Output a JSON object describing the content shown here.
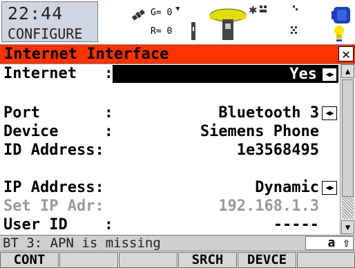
{
  "header": {
    "clock": "22:44",
    "mode": "CONFIGURE",
    "gps": {
      "g_label": "G= 0",
      "r_label": "R= 0"
    }
  },
  "title": "Internet Interface",
  "fields": [
    {
      "label": "Internet   :",
      "value": "Yes",
      "type": "select",
      "selected": true
    },
    {
      "label": "Port       :",
      "value": "Bluetooth 3",
      "type": "select"
    },
    {
      "label": "Device     :",
      "value": "Siemens Phone",
      "type": "readonly"
    },
    {
      "label": "ID Address:",
      "value": "1e3568495",
      "type": "readonly"
    },
    {
      "label": "IP Address:",
      "value": "Dynamic",
      "type": "select"
    },
    {
      "label": "Set IP Adr:",
      "value": "192.168.1.3",
      "type": "disabled"
    },
    {
      "label": "User ID    :",
      "value": "-----",
      "type": "input"
    }
  ],
  "message": "BT 3: APN is missing",
  "input_mode": "a ⇧",
  "softkeys": [
    "CONT",
    "",
    "",
    "SRCH",
    "DEVCE",
    ""
  ],
  "colors": {
    "title_bar": "#ff3300",
    "selection": "#000000"
  }
}
